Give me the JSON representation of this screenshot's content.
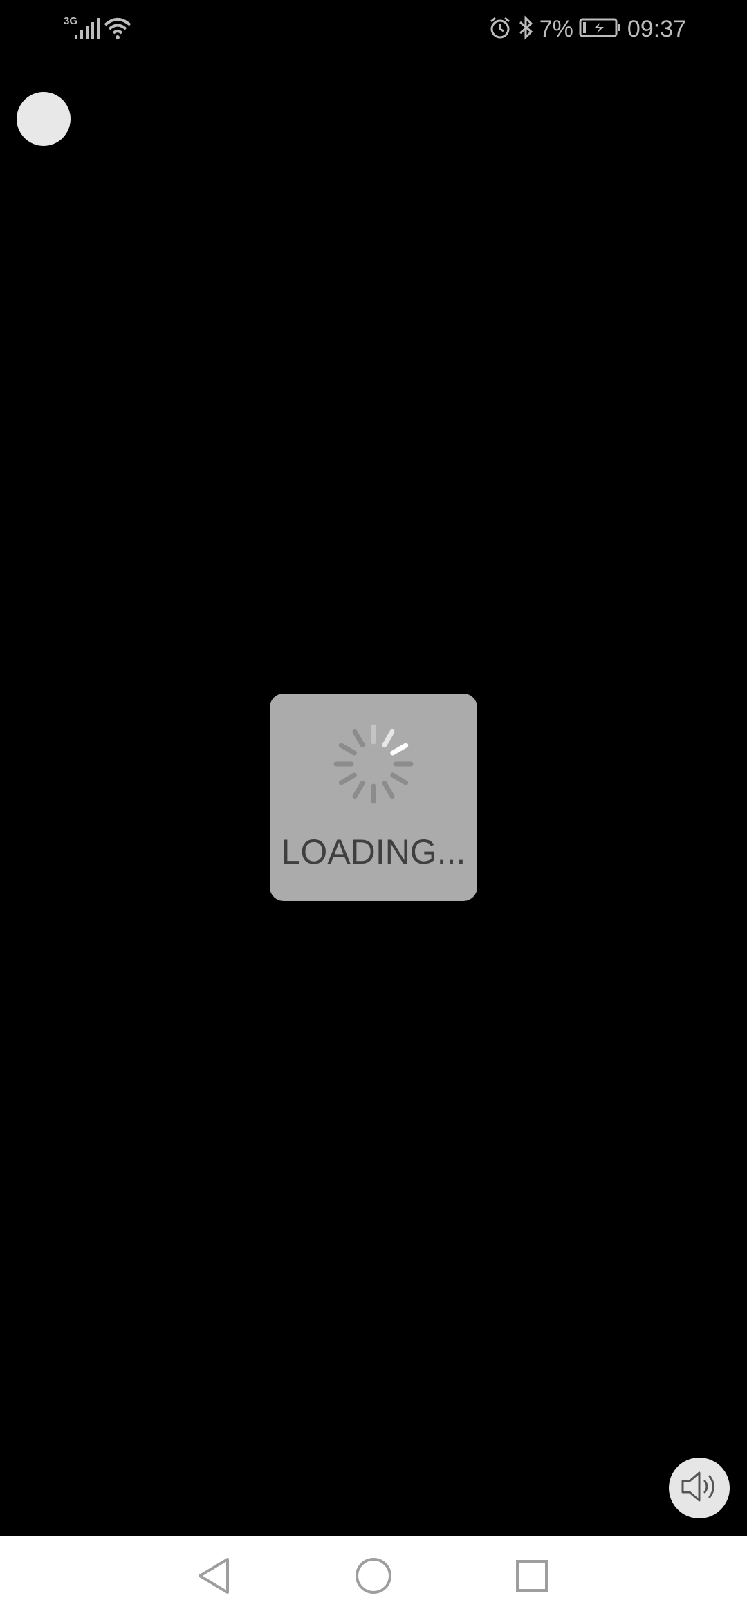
{
  "status_bar": {
    "network_type": "3G",
    "battery_percent": "7%",
    "time": "09:37",
    "icons": [
      "signal-icon",
      "wifi-icon",
      "alarm-icon",
      "bluetooth-icon",
      "battery-charging-icon"
    ]
  },
  "loading": {
    "text": "LOADING..."
  },
  "sound": {
    "icon": "speaker-icon"
  },
  "nav_bar": {
    "icons": [
      "back-icon",
      "home-icon",
      "recents-icon"
    ]
  },
  "colors": {
    "background": "#000000",
    "loading_box": "#ababab",
    "loading_text": "#3f3f3f",
    "status_text": "#bdbdbd",
    "nav_bar": "#ffffff"
  }
}
